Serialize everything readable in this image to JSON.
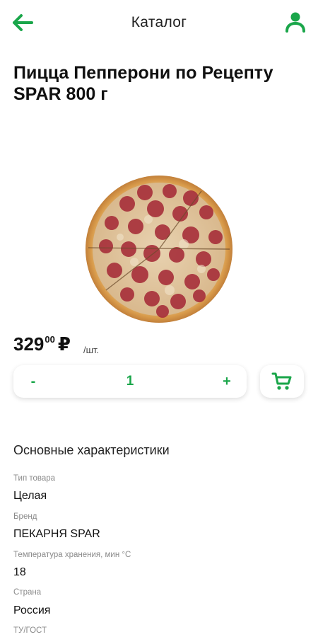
{
  "header": {
    "title": "Каталог",
    "back_icon": "arrow-left-icon",
    "profile_icon": "user-icon",
    "accent_color": "#1aa64a"
  },
  "product": {
    "title": "Пицца Пепперони по Рецепту SPAR 800 г",
    "image": "pepperoni-pizza-image"
  },
  "price": {
    "integer": "329",
    "decimal": "00",
    "currency": "₽",
    "unit": "/шт."
  },
  "quantity": {
    "minus_label": "-",
    "value": "1",
    "plus_label": "+"
  },
  "cart": {
    "icon": "cart-icon"
  },
  "specs": {
    "title": "Основные характеристики",
    "items": [
      {
        "label": "Тип товара",
        "value": "Целая"
      },
      {
        "label": "Бренд",
        "value": "ПЕКАРНЯ SPAR"
      },
      {
        "label": "Температура хранения, мин °С",
        "value": "18"
      },
      {
        "label": "Страна",
        "value": "Россия"
      },
      {
        "label": "ТУ/ГОСТ",
        "value": ""
      }
    ]
  }
}
